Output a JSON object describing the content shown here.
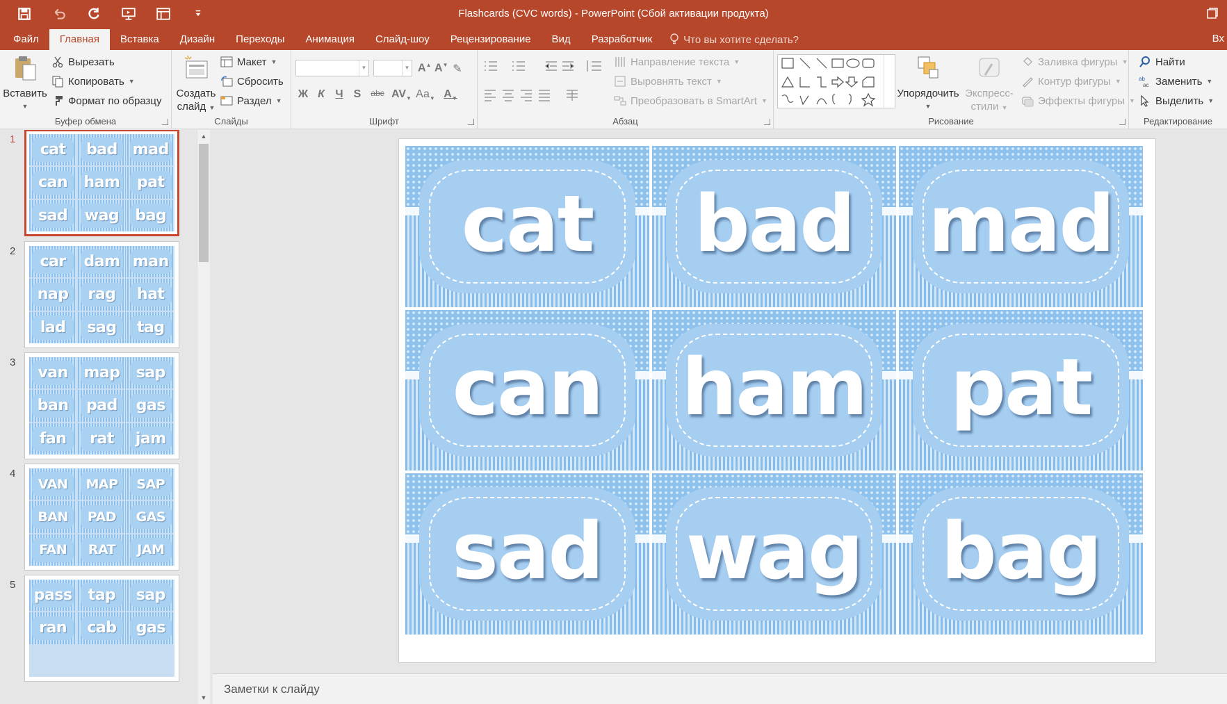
{
  "app": {
    "title": "Flashcards (CVC words) - PowerPoint (Сбой активации продукта)",
    "accent": "#b7472a"
  },
  "quick_access": {
    "icons": [
      "save-icon",
      "undo-icon",
      "redo-icon",
      "present-icon",
      "layout-icon",
      "customize-icon"
    ]
  },
  "tabs": {
    "items": [
      {
        "label": "Файл"
      },
      {
        "label": "Главная",
        "active": true
      },
      {
        "label": "Вставка"
      },
      {
        "label": "Дизайн"
      },
      {
        "label": "Переходы"
      },
      {
        "label": "Анимация"
      },
      {
        "label": "Слайд-шоу"
      },
      {
        "label": "Рецензирование"
      },
      {
        "label": "Вид"
      },
      {
        "label": "Разработчик"
      }
    ],
    "tell_me": "Что вы хотите сделать?",
    "login": "Вх"
  },
  "ribbon": {
    "clipboard": {
      "label": "Буфер обмена",
      "paste": "Вставить",
      "cut": "Вырезать",
      "copy": "Копировать",
      "format_painter": "Формат по образцу"
    },
    "slides": {
      "label": "Слайды",
      "new_slide_line1": "Создать",
      "new_slide_line2": "слайд",
      "layout": "Макет",
      "reset": "Сбросить",
      "section": "Раздел"
    },
    "font": {
      "label": "Шрифт",
      "bold": "Ж",
      "italic": "К",
      "underline": "Ч",
      "shadow": "S",
      "strike": "abc",
      "case": "Аа",
      "color": "А"
    },
    "paragraph": {
      "label": "Абзац",
      "text_direction": "Направление текста",
      "align_text": "Выровнять текст",
      "smartart": "Преобразовать в SmartArt"
    },
    "drawing": {
      "label": "Рисование",
      "arrange": "Упорядочить",
      "quick_styles_line1": "Экспресс-",
      "quick_styles_line2": "стили",
      "shape_fill": "Заливка фигуры",
      "shape_outline": "Контур фигуры",
      "shape_effects": "Эффекты фигуры"
    },
    "editing": {
      "label": "Редактирование",
      "find": "Найти",
      "replace": "Заменить",
      "select": "Выделить"
    }
  },
  "thumbnails": [
    {
      "number": "1",
      "words": [
        "cat",
        "bad",
        "mad",
        "can",
        "ham",
        "pat",
        "sad",
        "wag",
        "bag"
      ]
    },
    {
      "number": "2",
      "words": [
        "car",
        "dam",
        "man",
        "nap",
        "rag",
        "hat",
        "lad",
        "sag",
        "tag"
      ]
    },
    {
      "number": "3",
      "words": [
        "van",
        "map",
        "sap",
        "ban",
        "pad",
        "gas",
        "fan",
        "rat",
        "jam"
      ]
    },
    {
      "number": "4",
      "words": [
        "VAN",
        "MAP",
        "SAP",
        "BAN",
        "PAD",
        "GAS",
        "FAN",
        "RAT",
        "JAM"
      ]
    },
    {
      "number": "5",
      "words": [
        "pass",
        "tap",
        "sap",
        "ran",
        "cab",
        "gas"
      ]
    }
  ],
  "slide": {
    "words": [
      "cat",
      "bad",
      "mad",
      "can",
      "ham",
      "pat",
      "sad",
      "wag",
      "bag"
    ],
    "card_color": "#a6cef1",
    "background_color": "#8ec1ec"
  },
  "notes": {
    "placeholder": "Заметки к слайду"
  }
}
